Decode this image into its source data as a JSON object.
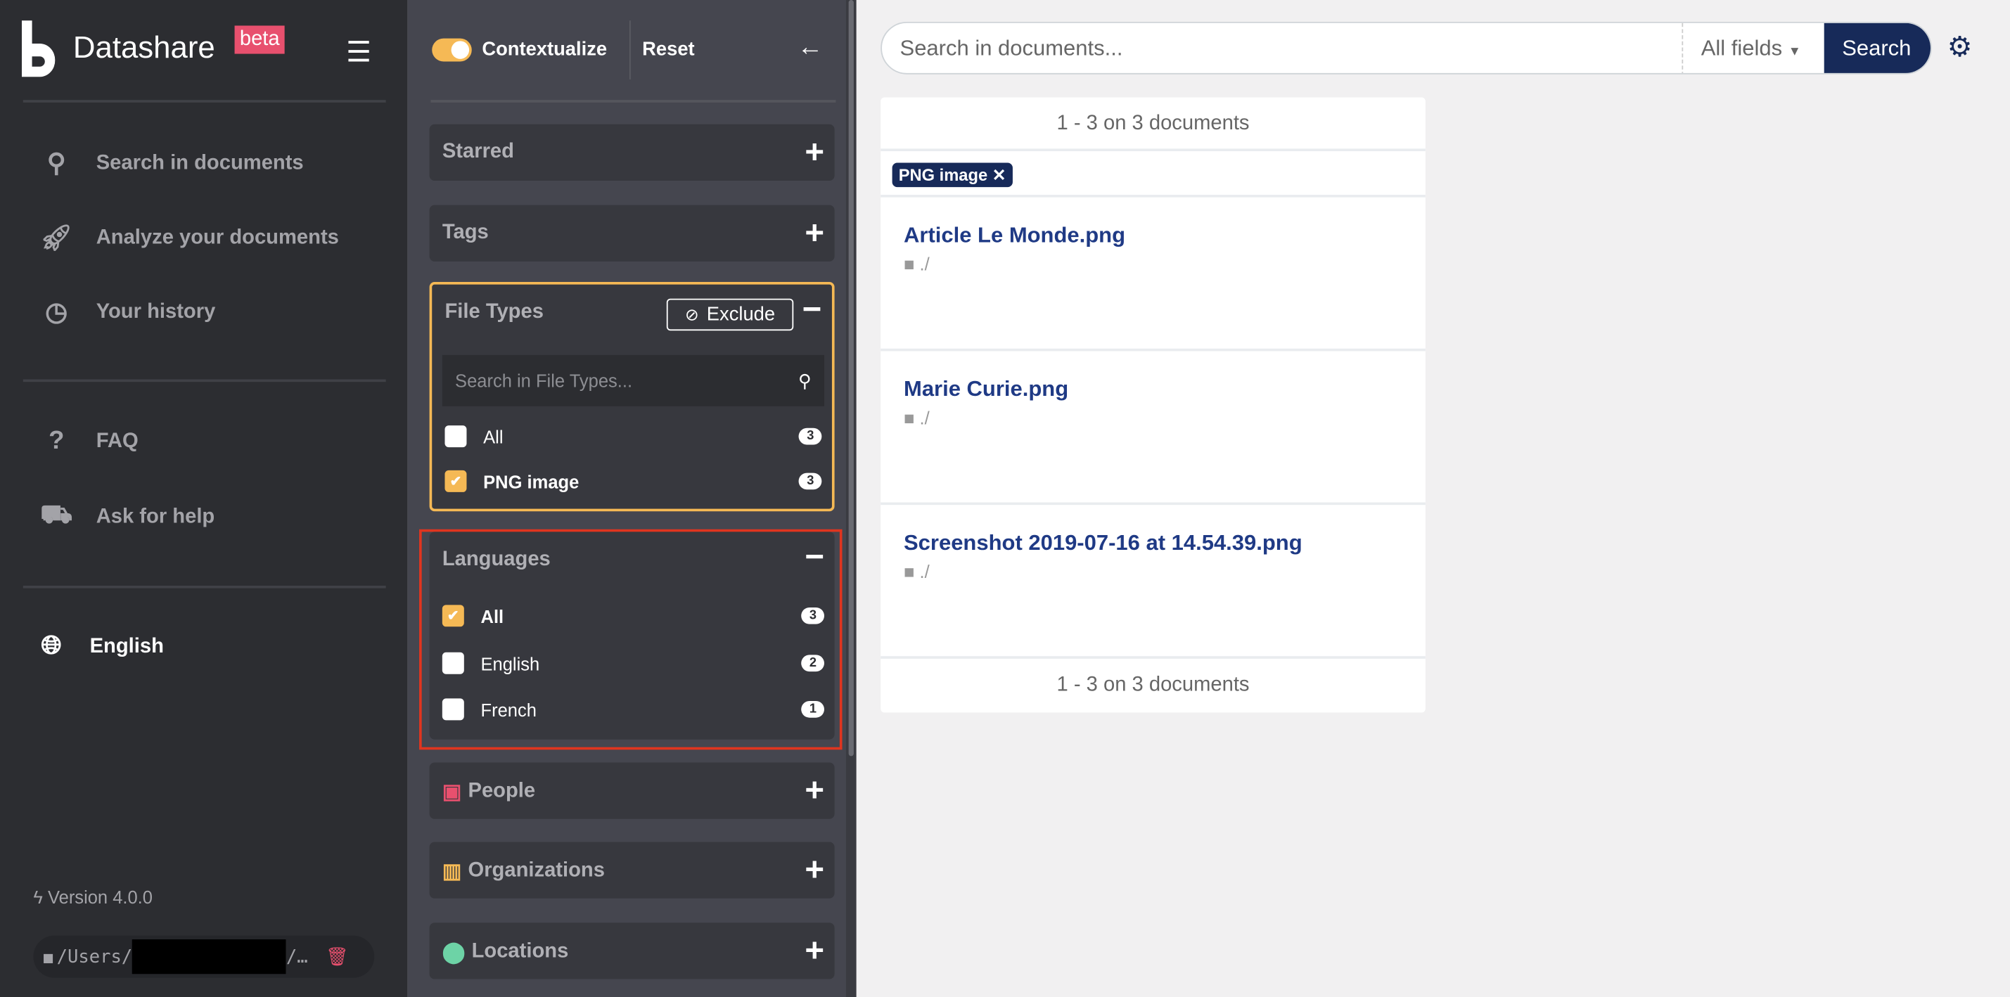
{
  "app": {
    "name": "Datashare",
    "badge": "beta"
  },
  "sidebar": {
    "items": [
      {
        "label": "Search in documents",
        "icon": "search-icon"
      },
      {
        "label": "Analyze your documents",
        "icon": "rocket-icon"
      },
      {
        "label": "Your history",
        "icon": "clock-icon"
      },
      {
        "label": "FAQ",
        "icon": "question-icon"
      },
      {
        "label": "Ask for help",
        "icon": "ambulance-icon"
      }
    ],
    "language": "English",
    "version": "Version 4.0.0",
    "path": "/Users/",
    "path_tail": "/…"
  },
  "filters": {
    "contextualize": "Contextualize",
    "reset": "Reset",
    "starred": "Starred",
    "tags": "Tags",
    "file_types": {
      "title": "File Types",
      "exclude": "Exclude",
      "search_placeholder": "Search in File Types...",
      "options": [
        {
          "label": "All",
          "count": "3",
          "checked": false
        },
        {
          "label": "PNG image",
          "count": "3",
          "checked": true
        }
      ]
    },
    "languages": {
      "title": "Languages",
      "options": [
        {
          "label": "All",
          "count": "3",
          "checked": true
        },
        {
          "label": "English",
          "count": "2",
          "checked": false
        },
        {
          "label": "French",
          "count": "1",
          "checked": false
        }
      ]
    },
    "people": "People",
    "organizations": "Organizations",
    "locations": "Locations"
  },
  "search": {
    "placeholder": "Search in documents...",
    "field": "All fields",
    "button": "Search"
  },
  "results": {
    "summary": "1 - 3  on 3 documents",
    "active_filter": "PNG image",
    "documents": [
      {
        "title": "Article Le Monde.png",
        "path": "./"
      },
      {
        "title": "Marie Curie.png",
        "path": "./"
      },
      {
        "title": "Screenshot 2019-07-16 at 14.54.39.png",
        "path": "./"
      }
    ]
  },
  "colors": {
    "accent": "#f5b955",
    "primary": "#172a59",
    "beta": "#e8506e",
    "highlight": "#e0351f"
  }
}
